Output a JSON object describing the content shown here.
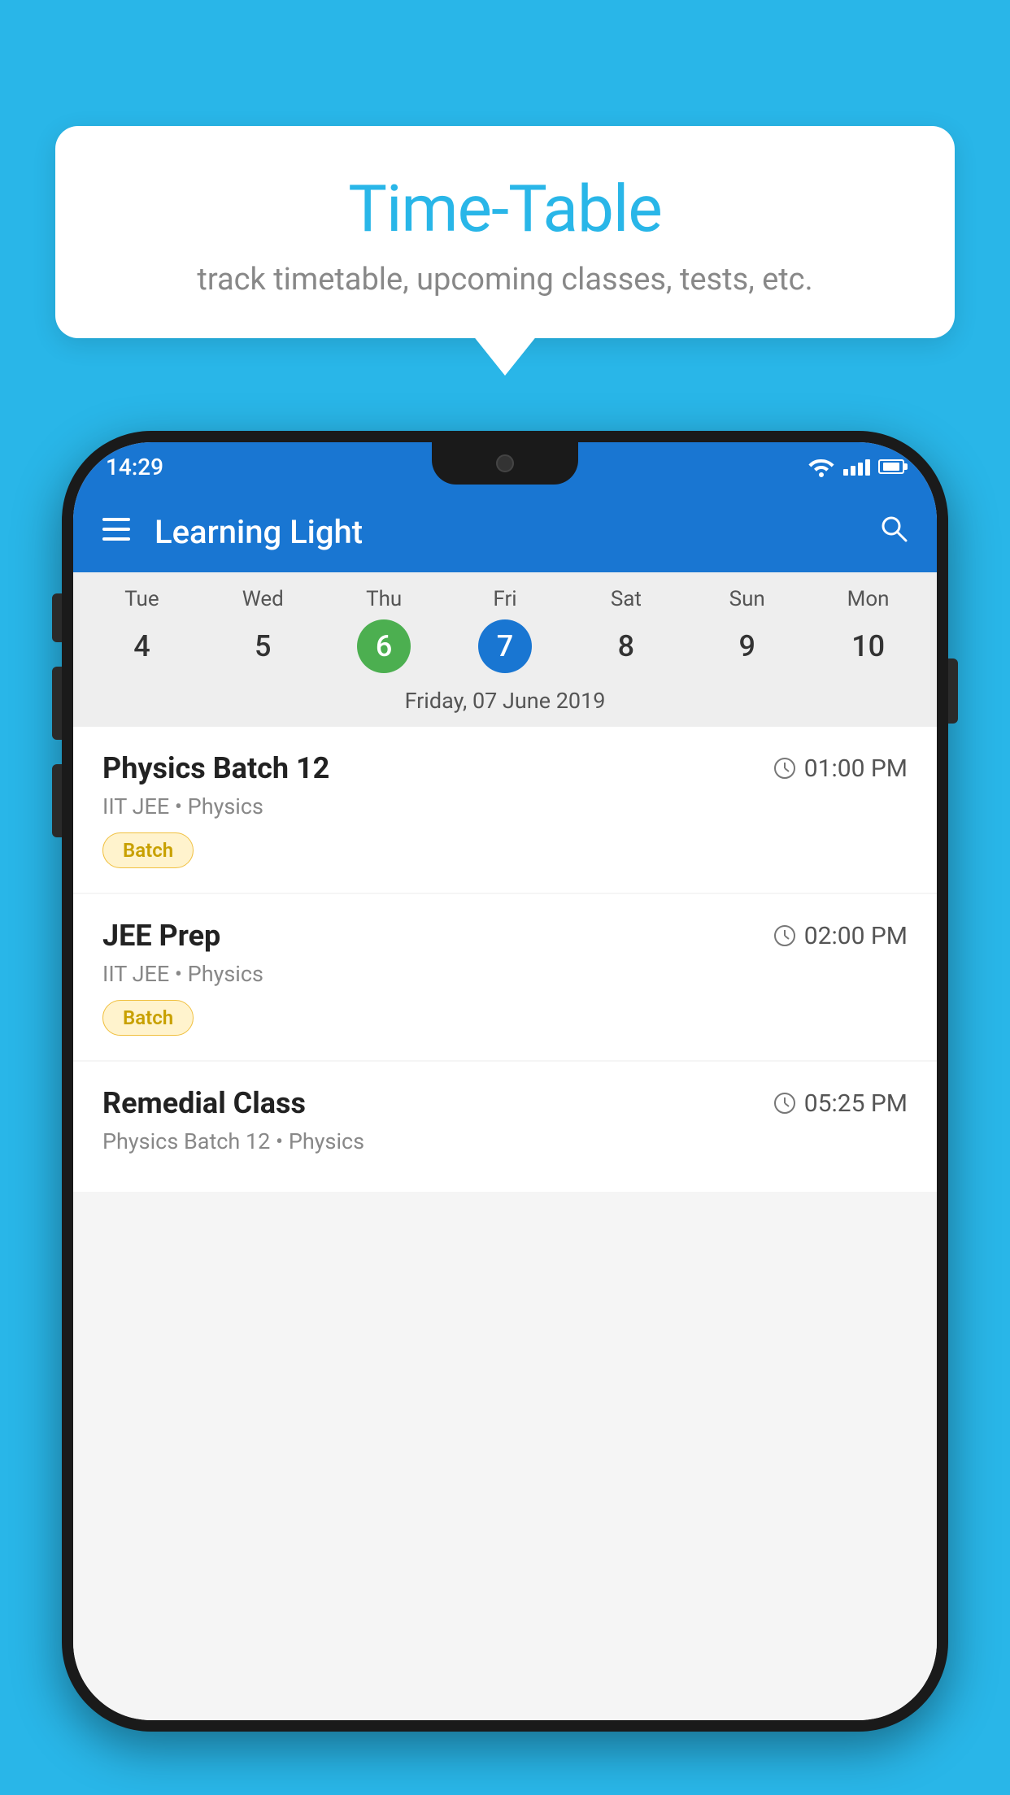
{
  "background_color": "#29b6e8",
  "tooltip": {
    "title": "Time-Table",
    "subtitle": "track timetable, upcoming classes, tests, etc."
  },
  "phone": {
    "status_bar": {
      "time": "14:29"
    },
    "app_bar": {
      "title": "Learning Light",
      "menu_icon": "☰",
      "search_icon": "🔍"
    },
    "calendar": {
      "days": [
        {
          "name": "Tue",
          "num": "4",
          "state": "normal"
        },
        {
          "name": "Wed",
          "num": "5",
          "state": "normal"
        },
        {
          "name": "Thu",
          "num": "6",
          "state": "today"
        },
        {
          "name": "Fri",
          "num": "7",
          "state": "selected"
        },
        {
          "name": "Sat",
          "num": "8",
          "state": "normal"
        },
        {
          "name": "Sun",
          "num": "9",
          "state": "normal"
        },
        {
          "name": "Mon",
          "num": "10",
          "state": "normal"
        }
      ],
      "selected_date_label": "Friday, 07 June 2019"
    },
    "classes": [
      {
        "name": "Physics Batch 12",
        "time": "01:00 PM",
        "meta": "IIT JEE • Physics",
        "badge": "Batch"
      },
      {
        "name": "JEE Prep",
        "time": "02:00 PM",
        "meta": "IIT JEE • Physics",
        "badge": "Batch"
      },
      {
        "name": "Remedial Class",
        "time": "05:25 PM",
        "meta": "Physics Batch 12 • Physics",
        "badge": null
      }
    ]
  }
}
